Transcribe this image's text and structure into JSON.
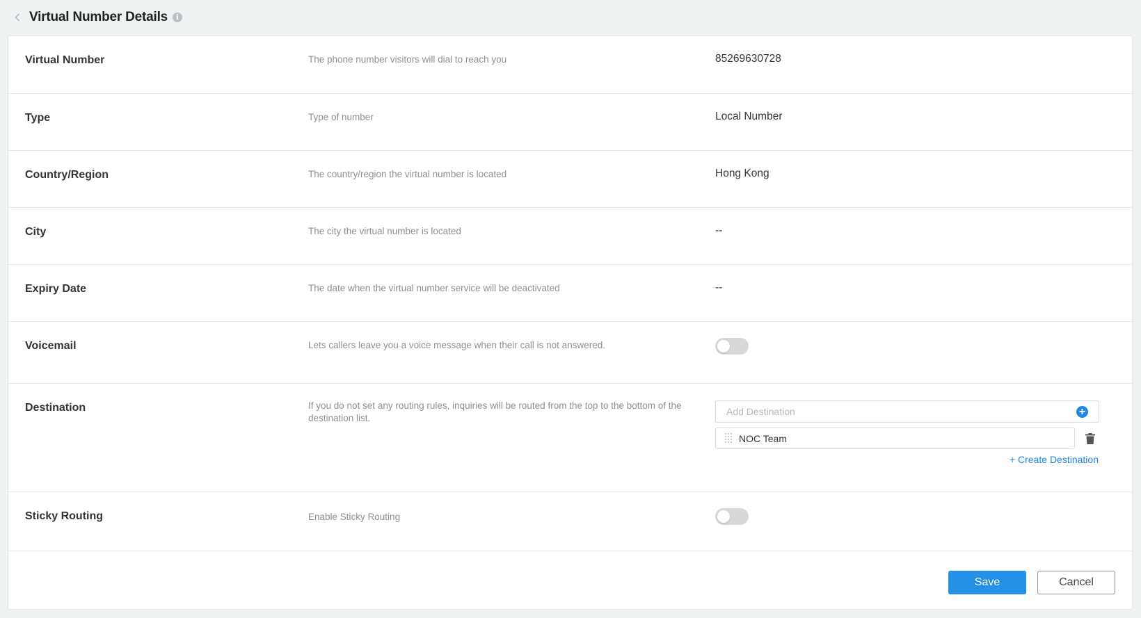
{
  "header": {
    "title": "Virtual Number Details",
    "info_icon": "info-icon",
    "back_icon": "chevron-left-icon"
  },
  "rows": [
    {
      "label": "Virtual Number",
      "description": "The phone number visitors will dial to reach you",
      "value": "85269630728"
    },
    {
      "label": "Type",
      "description": "Type of number",
      "value": "Local Number"
    },
    {
      "label": "Country/Region",
      "description": "The country/region the virtual number is located",
      "value": "Hong Kong"
    },
    {
      "label": "City",
      "description": "The city the virtual number is located",
      "value": "--"
    },
    {
      "label": "Expiry Date",
      "description": "The date when the virtual number service will be deactivated",
      "value": "--"
    },
    {
      "label": "Voicemail",
      "description": "Lets callers leave you a voice message when their call is not answered.",
      "toggle_on": false
    },
    {
      "label": "Destination",
      "description": "If you do not set any routing rules, inquiries will be routed from the top to the bottom of the destination list."
    },
    {
      "label": "Sticky Routing",
      "description": "Enable Sticky Routing",
      "toggle_on": false
    }
  ],
  "destination": {
    "input_placeholder": "Add Destination",
    "items": [
      {
        "name": "NOC Team"
      }
    ],
    "create_link": "+ Create Destination"
  },
  "footer": {
    "save_label": "Save",
    "cancel_label": "Cancel"
  },
  "colors": {
    "accent": "#2491e6",
    "link": "#1f87e5",
    "background": "#eef2f3"
  }
}
